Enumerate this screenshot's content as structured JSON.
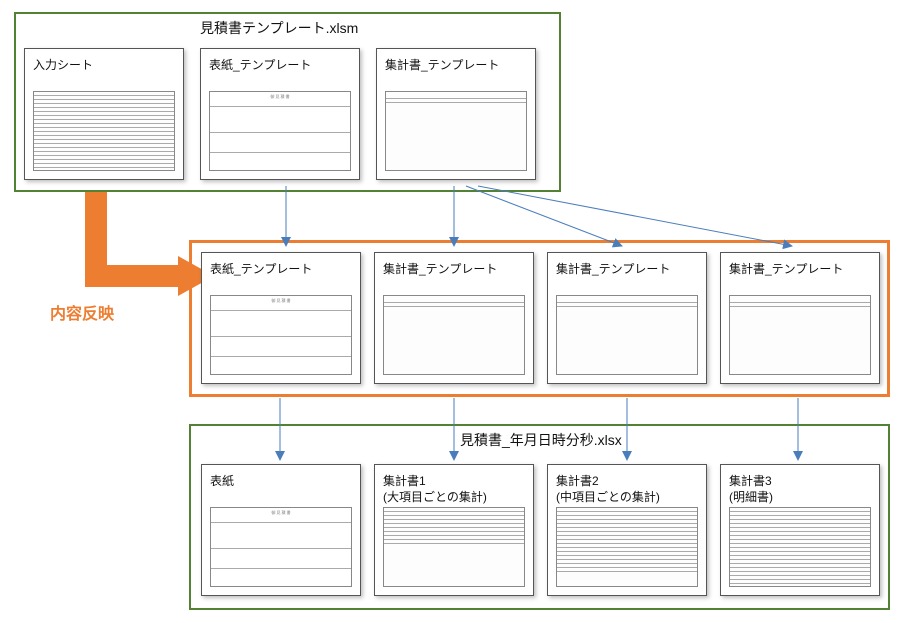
{
  "group_top": {
    "title": "見積書テンプレート.xlsm"
  },
  "group_bottom": {
    "title": "見積書_年月日時分秒.xlsx"
  },
  "arrow_label": "内容反映",
  "row_top": [
    {
      "title": "入力シート"
    },
    {
      "title": "表紙_テンプレート"
    },
    {
      "title": "集計書_テンプレート"
    }
  ],
  "row_mid": [
    {
      "title": "表紙_テンプレート"
    },
    {
      "title": "集計書_テンプレート"
    },
    {
      "title": "集計書_テンプレート"
    },
    {
      "title": "集計書_テンプレート"
    }
  ],
  "row_bot": [
    {
      "title": "表紙"
    },
    {
      "title": "集計書1\n(大項目ごとの集計)"
    },
    {
      "title": "集計書2\n(中項目ごとの集計)"
    },
    {
      "title": "集計書3\n(明細書)"
    }
  ]
}
